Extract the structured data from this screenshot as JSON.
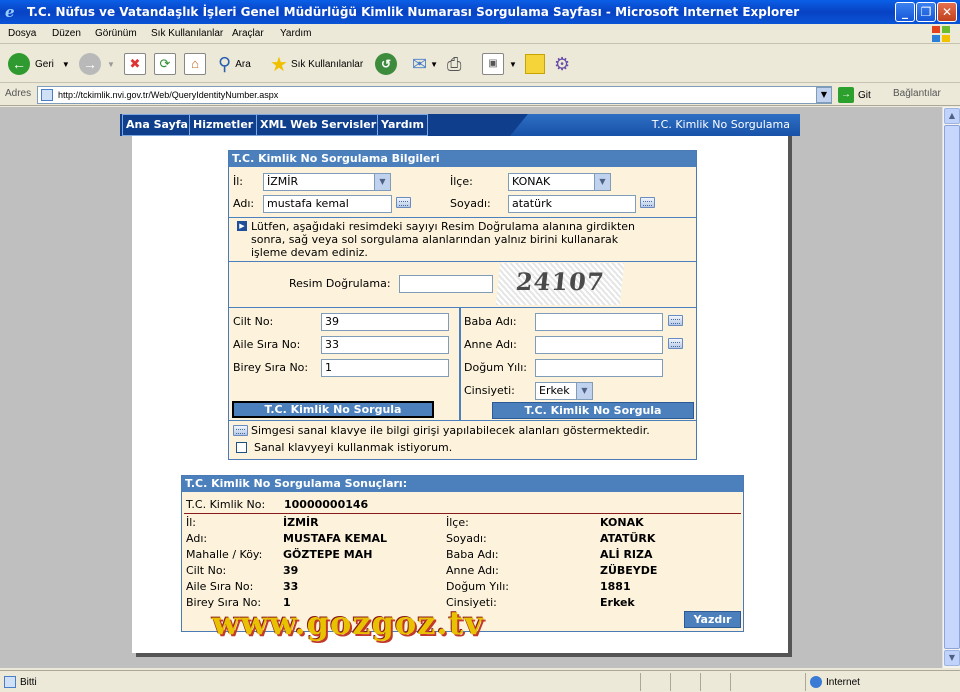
{
  "window": {
    "title": "T.C. Nüfus ve Vatandaşlık İşleri Genel Müdürlüğü Kimlik Numarası Sorgulama Sayfası - Microsoft Internet Explorer"
  },
  "menu": [
    "Dosya",
    "Düzen",
    "Görünüm",
    "Sık Kullanılanlar",
    "Araçlar",
    "Yardım"
  ],
  "toolbar": {
    "back_label": "Geri",
    "search_label": "Ara",
    "favorites_label": "Sık Kullanılanlar"
  },
  "address": {
    "label": "Adres",
    "url": "http://tckimlik.nvi.gov.tr/Web/QueryIdentityNumber.aspx",
    "go_label": "Git",
    "links_label": "Bağlantılar"
  },
  "site_nav": {
    "items": [
      "Ana Sayfa",
      "Hizmetler",
      "XML Web Servisleri",
      "Yardım"
    ],
    "page_title": "T.C. Kimlik No Sorgulama"
  },
  "query": {
    "header": "T.C. Kimlik No Sorgulama Bilgileri",
    "il_label": "İl:",
    "il_value": "İZMİR",
    "ilce_label": "İlçe:",
    "ilce_value": "KONAK",
    "adi_label": "Adı:",
    "adi_value": "mustafa kemal",
    "soyadi_label": "Soyadı:",
    "soyadi_value": "atatürk",
    "info_text_1": "Lütfen, aşağıdaki resimdeki sayıyı Resim Doğrulama alanına girdikten",
    "info_text_2": "sonra, sağ veya sol sorgulama alanlarından yalnız birini kullanarak",
    "info_text_3": "işleme devam ediniz.",
    "captcha_label": "Resim Doğrulama:",
    "captcha_value": "",
    "captcha_image_text": "24107",
    "cilt_label": "Cilt No:",
    "cilt_value": "39",
    "aile_label": "Aile Sıra No:",
    "aile_value": "33",
    "birey_label": "Birey Sıra No:",
    "birey_value": "1",
    "baba_label": "Baba Adı:",
    "baba_value": "",
    "anne_label": "Anne Adı:",
    "anne_value": "",
    "dogum_label": "Doğum Yılı:",
    "dogum_value": "",
    "cinsiyet_label": "Cinsiyeti:",
    "cinsiyet_value": "Erkek",
    "left_button": "T.C. Kimlik No Sorgula",
    "right_button": "T.C. Kimlik No Sorgula",
    "keyboard_note": "Simgesi sanal klavye ile bilgi girişi yapılabilecek alanları göstermektedir.",
    "keyboard_checkbox_label": "Sanal klavyeyi kullanmak istiyorum."
  },
  "results": {
    "header": "T.C. Kimlik No Sorgulama Sonuçları:",
    "tc_label": "T.C. Kimlik No:",
    "tc_value": "10000000146",
    "rows_left": [
      {
        "label": "İl:",
        "value": "İZMİR"
      },
      {
        "label": "Adı:",
        "value": "MUSTAFA KEMAL"
      },
      {
        "label": "Mahalle / Köy:",
        "value": "GÖZTEPE MAH"
      },
      {
        "label": "Cilt No:",
        "value": "39"
      },
      {
        "label": "Aile Sıra No:",
        "value": "33"
      },
      {
        "label": "Birey Sıra No:",
        "value": "1"
      }
    ],
    "rows_right": [
      {
        "label": "İlçe:",
        "value": "KONAK"
      },
      {
        "label": "Soyadı:",
        "value": "ATATÜRK"
      },
      {
        "label": "Baba Adı:",
        "value": "ALİ RIZA"
      },
      {
        "label": "Anne Adı:",
        "value": "ZÜBEYDE"
      },
      {
        "label": "Doğum Yılı:",
        "value": "1881"
      },
      {
        "label": "Cinsiyeti:",
        "value": "Erkek"
      }
    ],
    "print_button": "Yazdır"
  },
  "watermark": "www.gozgoz.tv",
  "status": {
    "left": "Bitti",
    "right": "Internet"
  },
  "colors": {
    "panel_header": "#4b80bd",
    "panel_bg": "#fdf3dc",
    "nav_bg": "#0f3f8c"
  }
}
